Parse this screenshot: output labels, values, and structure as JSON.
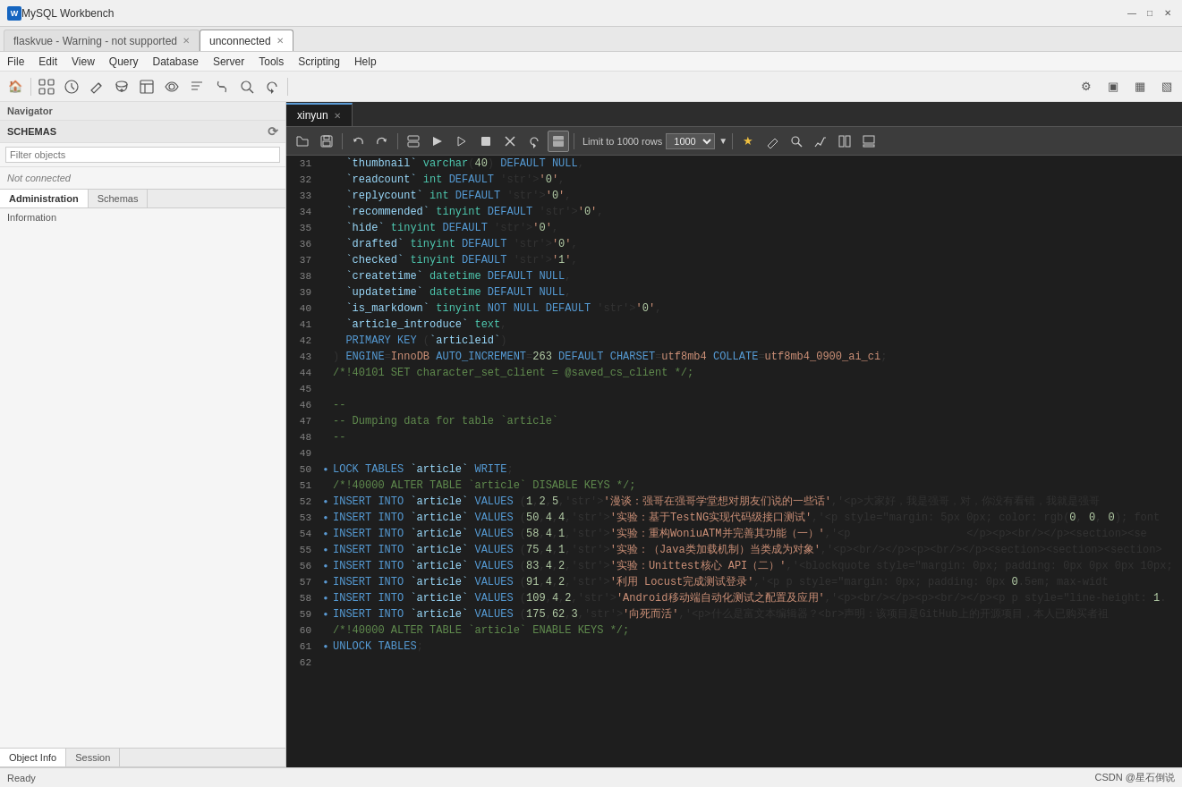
{
  "app": {
    "title": "MySQL Workbench",
    "icon": "wb"
  },
  "titlebar": {
    "title": "MySQL Workbench",
    "minimize": "—",
    "maximize": "□",
    "close": "✕"
  },
  "tabs": [
    {
      "label": "flaskvue - Warning - not supported",
      "active": false,
      "closable": true
    },
    {
      "label": "unconnected",
      "active": true,
      "closable": true
    }
  ],
  "menubar": {
    "items": [
      "File",
      "Edit",
      "View",
      "Query",
      "Database",
      "Server",
      "Tools",
      "Scripting",
      "Help"
    ]
  },
  "sidebar": {
    "header": "Navigator",
    "schemas_label": "SCHEMAS",
    "filter_placeholder": "Filter objects",
    "not_connected": "Not connected",
    "tabs": [
      "Administration",
      "Schemas"
    ],
    "active_tab": "Administration",
    "info_label": "Information",
    "bottom_tabs": [
      "Object Info",
      "Session"
    ],
    "active_bottom_tab": "Object Info"
  },
  "editor": {
    "tab_label": "xinyun",
    "toolbar": {
      "open": "📁",
      "save": "💾",
      "undo_exec": "↩",
      "redo_exec": "↪",
      "toggle_results": "▦",
      "exec_all": "▶",
      "exec_current": "▷",
      "stop": "⏹",
      "stop_all": "⏺",
      "refresh": "↺",
      "limit_label": "Limit to 1000 rows",
      "find": "🔍",
      "bookmark": "★",
      "explain": "📋",
      "exec_explain": "⚡",
      "toggle_schema": "◫",
      "toggle_output": "▣"
    }
  },
  "code": {
    "lines": [
      {
        "num": 31,
        "dot": false,
        "content": "  `thumbnail` varchar(40) DEFAULT NULL,"
      },
      {
        "num": 32,
        "dot": false,
        "content": "  `readcount` int DEFAULT '0',"
      },
      {
        "num": 33,
        "dot": false,
        "content": "  `replycount` int DEFAULT '0',"
      },
      {
        "num": 34,
        "dot": false,
        "content": "  `recommended` tinyint DEFAULT '0',"
      },
      {
        "num": 35,
        "dot": false,
        "content": "  `hide` tinyint DEFAULT '0',"
      },
      {
        "num": 36,
        "dot": false,
        "content": "  `drafted` tinyint DEFAULT '0',"
      },
      {
        "num": 37,
        "dot": false,
        "content": "  `checked` tinyint DEFAULT '1',"
      },
      {
        "num": 38,
        "dot": false,
        "content": "  `createtime` datetime DEFAULT NULL,"
      },
      {
        "num": 39,
        "dot": false,
        "content": "  `updatetime` datetime DEFAULT NULL,"
      },
      {
        "num": 40,
        "dot": false,
        "content": "  `is_markdown` tinyint NOT NULL DEFAULT '0',"
      },
      {
        "num": 41,
        "dot": false,
        "content": "  `article_introduce` text,"
      },
      {
        "num": 42,
        "dot": false,
        "content": "  PRIMARY KEY (`articleid`)"
      },
      {
        "num": 43,
        "dot": false,
        "content": ") ENGINE=InnoDB AUTO_INCREMENT=263 DEFAULT CHARSET=utf8mb4 COLLATE=utf8mb4_0900_ai_ci;"
      },
      {
        "num": 44,
        "dot": false,
        "content": "/*!40101 SET character_set_client = @saved_cs_client */;"
      },
      {
        "num": 45,
        "dot": false,
        "content": ""
      },
      {
        "num": 46,
        "dot": false,
        "content": "--"
      },
      {
        "num": 47,
        "dot": false,
        "content": "-- Dumping data for table `article`"
      },
      {
        "num": 48,
        "dot": false,
        "content": "--"
      },
      {
        "num": 49,
        "dot": false,
        "content": ""
      },
      {
        "num": 50,
        "dot": true,
        "content": "LOCK TABLES `article` WRITE;"
      },
      {
        "num": 51,
        "dot": false,
        "content": "/*!40000 ALTER TABLE `article` DISABLE KEYS */;"
      },
      {
        "num": 52,
        "dot": true,
        "content": "INSERT INTO `article` VALUES (1,2,5,'漫谈：强哥在强哥学堂想对朋友们说的一些话','<p>大家好，我是强哥，对，你没有看错，我就是强哥"
      },
      {
        "num": 53,
        "dot": true,
        "content": "INSERT INTO `article` VALUES (50,4,4,'实验：基于TestNG实现代码级接口测试','<p style=\"margin: 5px 0px; color: rgb(0, 0, 0); font"
      },
      {
        "num": 54,
        "dot": true,
        "content": "INSERT INTO `article` VALUES (58,4,1,'实验：重构WoniuATM并完善其功能（一）','<p                  </p><p><br/></p><section><se"
      },
      {
        "num": 55,
        "dot": true,
        "content": "INSERT INTO `article` VALUES (75,4,1,'实验：（Java类加载机制）当类成为对象','<p><br/></p><p><br/></p><section><section><section>"
      },
      {
        "num": 56,
        "dot": true,
        "content": "INSERT INTO `article` VALUES (83,4,2,'实验：Unittest核心 API（二）','<blockquote style=\"margin: 0px; padding: 0px 0px 0px 10px;"
      },
      {
        "num": 57,
        "dot": true,
        "content": "INSERT INTO `article` VALUES (91,4,2,'利用 Locust完成测试登录','<p p style=\"margin: 0px; padding: 0px 0.5em; max-widt"
      },
      {
        "num": 58,
        "dot": true,
        "content": "INSERT INTO `article` VALUES (109,4,2,'Android移动端自动化测试之配置及应用','<p><br/></p><p><br/></p><p p style=\"line-height: 1."
      },
      {
        "num": 59,
        "dot": true,
        "content": "INSERT INTO `article` VALUES (175,62,3,'向死而活','<p>什么是富文本编辑器？<br>声明：该项目是GitHub上的开源项目，本人已购买者祖"
      },
      {
        "num": 60,
        "dot": false,
        "content": "/*!40000 ALTER TABLE `article` ENABLE KEYS */;"
      },
      {
        "num": 61,
        "dot": true,
        "content": "UNLOCK TABLES;"
      },
      {
        "num": 62,
        "dot": false,
        "content": ""
      }
    ]
  },
  "statusbar": {
    "left": "Ready",
    "right": "CSDN @星石倒说"
  }
}
